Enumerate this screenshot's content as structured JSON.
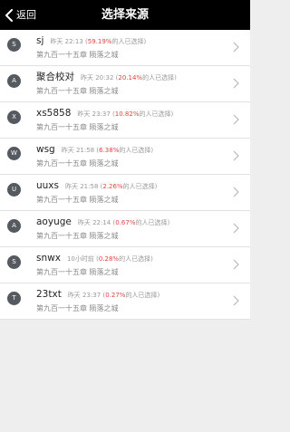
{
  "nav": {
    "back_label": "返回",
    "title": "选择来源"
  },
  "sources": [
    {
      "initial": "S",
      "name": "sj",
      "time": "昨天 22:13",
      "percent": "59.19%",
      "suffix": "的人已选择",
      "chapter": "第九百一十五章  陨落之城"
    },
    {
      "initial": "A",
      "name": "聚合校对",
      "time": "昨天 20:32",
      "percent": "20.14%",
      "suffix": "的人已选择",
      "chapter": "第九百一十五章  陨落之城"
    },
    {
      "initial": "X",
      "name": "xs5858",
      "time": "昨天 23:37",
      "percent": "10.82%",
      "suffix": "的人已选择",
      "chapter": "第九百一十五章  陨落之城"
    },
    {
      "initial": "W",
      "name": "wsg",
      "time": "昨天 21:58",
      "percent": "6.38%",
      "suffix": "的人已选择",
      "chapter": "第九百一十五章  陨落之城"
    },
    {
      "initial": "U",
      "name": "uuxs",
      "time": "昨天 21:58",
      "percent": "2.26%",
      "suffix": "的人已选择",
      "chapter": "第九百一十五章  陨落之城"
    },
    {
      "initial": "A",
      "name": "aoyuge",
      "time": "昨天 22:14",
      "percent": "0.67%",
      "suffix": "的人已选择",
      "chapter": "第九百一十五章  陨落之城"
    },
    {
      "initial": "S",
      "name": "snwx",
      "time": "10小时前",
      "percent": "0.28%",
      "suffix": "的人已选择",
      "chapter": "第九百一十五章  陨落之城"
    },
    {
      "initial": "T",
      "name": "23txt",
      "time": "昨天 23:37",
      "percent": "0.27%",
      "suffix": "的人已选择",
      "chapter": "第九百一十五章  陨落之城"
    }
  ],
  "colors": {
    "nav_bg": "#000000",
    "accent_percent": "#e0453e",
    "avatar_bg": "#555a60",
    "page_bg": "#eeeeee"
  },
  "icons": {
    "back": "chevron-left-icon",
    "row_arrow": "chevron-right-icon"
  }
}
